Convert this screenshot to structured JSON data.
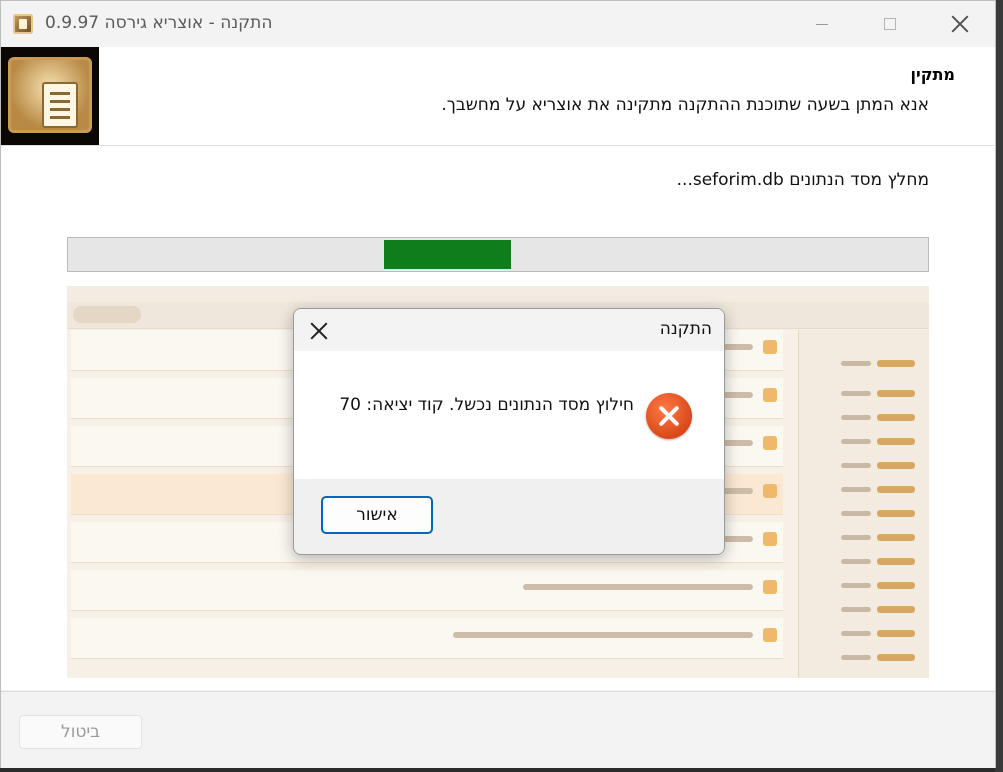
{
  "window": {
    "title": "התקנה - אוצריא גירסה 0.9.97"
  },
  "header": {
    "title": "מתקין",
    "subtitle": "אנא המתן בשעה שתוכנת ההתקנה מתקינה את אוצריא על מחשבך."
  },
  "status": {
    "text": "מחלץ מסד הנתונים seforim.db..."
  },
  "progress": {
    "fill_start_fraction": 0.368,
    "fill_end_fraction": 0.516,
    "fill_color": "#0f7d1c"
  },
  "dialog": {
    "title": "התקנה",
    "message": "חילוץ מסד הנתונים נכשל. קוד יציאה: 70",
    "ok_label": "אישור",
    "icon": "error-icon"
  },
  "footer": {
    "cancel_label": "ביטול"
  },
  "colors": {
    "accent_blue": "#0067c0",
    "error_orange": "#e2501f"
  }
}
